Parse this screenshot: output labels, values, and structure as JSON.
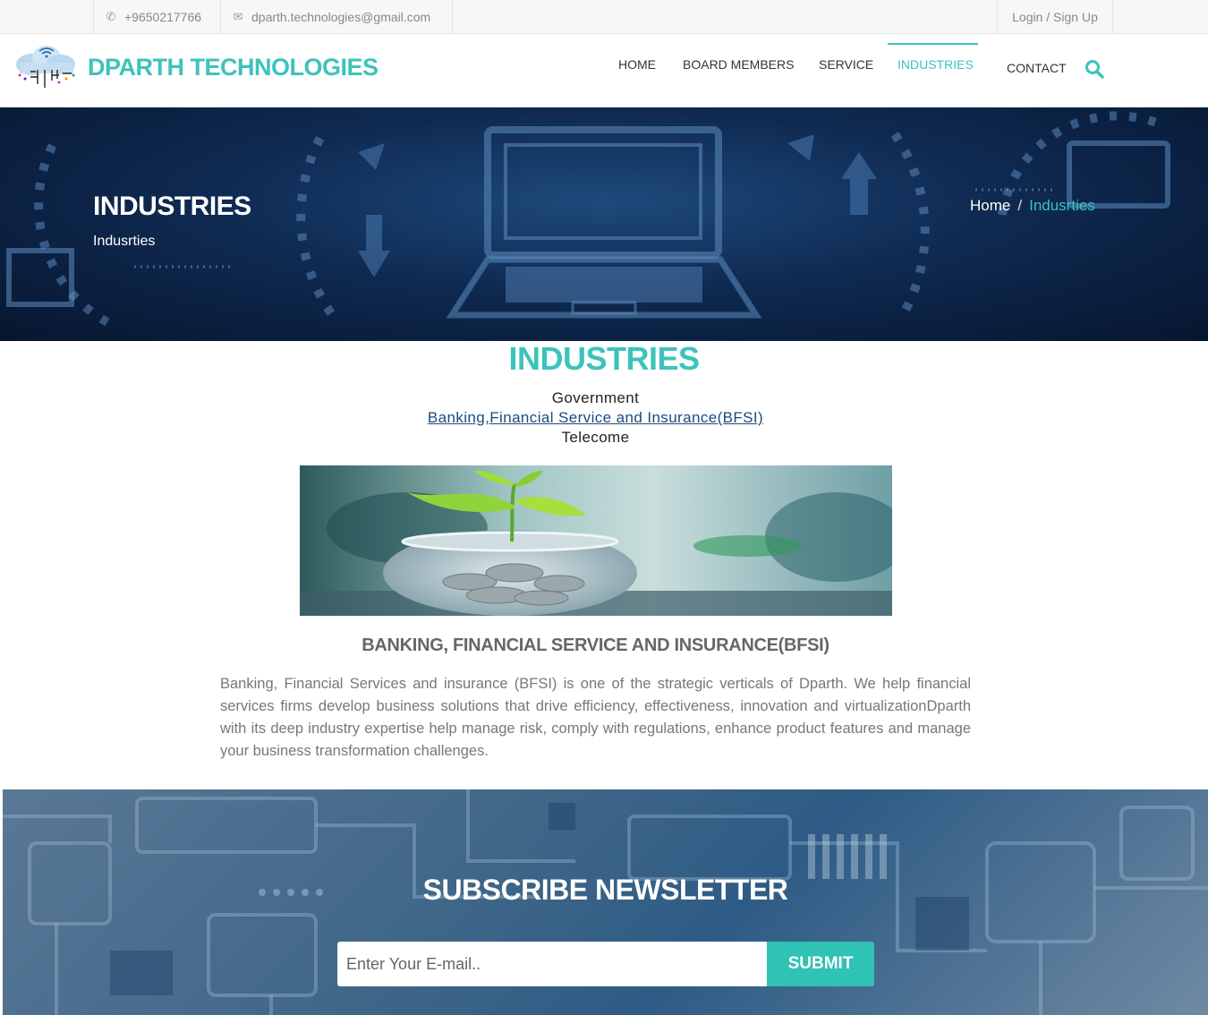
{
  "topbar": {
    "phone": "+9650217766",
    "email": "dparth.technologies@gmail.com",
    "login": "Login / Sign Up"
  },
  "header": {
    "brand": "DPARTH TECHNOLOGIES",
    "nav": [
      "HOME",
      "BOARD MEMBERS",
      "SERVICE",
      "INDUSTRIES",
      "CONTACT"
    ],
    "active_nav": "INDUSTRIES"
  },
  "hero": {
    "title": "INDUSTRIES",
    "subtitle": "Indusrties",
    "breadcrumb": {
      "home": "Home",
      "separator": "/",
      "current": "Indusrties"
    }
  },
  "industries": {
    "title": "INDUSTRIES",
    "items": [
      "Government",
      "Banking,Financial Service and Insurance(BFSI)",
      "Telecome"
    ]
  },
  "card": {
    "title": "BANKING, FINANCIAL SERVICE AND INSURANCE(BFSI)",
    "description": "Banking, Financial Services and insurance (BFSI) is one of the strategic verticals of Dparth. We help financial services firms develop business solutions that drive efficiency, effectiveness, innovation and virtualizationDparth with its deep industry expertise help manage risk, comply with regulations, enhance product features and manage your business transformation challenges."
  },
  "newsletter": {
    "title": "SUBSCRIBE NEWSLETTER",
    "email_placeholder": "Enter Your E-mail..",
    "submit": "SUBMIT"
  },
  "colors": {
    "accent": "#3dc3bb",
    "button": "#2fc2b5",
    "link": "#1a4b7a"
  },
  "icons": [
    "phone-icon",
    "envelope-icon",
    "search-icon",
    "cloud-logo-icon"
  ]
}
